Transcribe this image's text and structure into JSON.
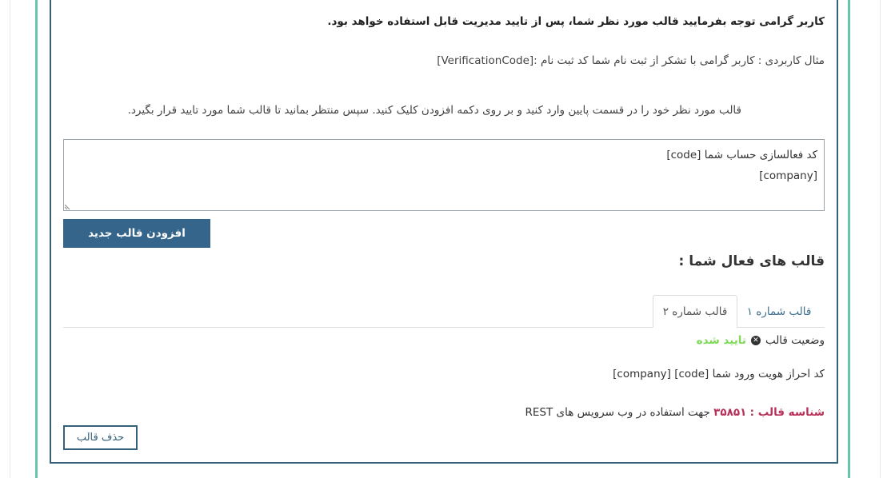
{
  "notice": "کاربر گرامی توجه بفرمایید قالب مورد نظر شما، پس از تایید مدیریت قابل استفاده خواهد بود.",
  "example": "مثال کاربردی : کاربر گرامی با تشکر از ثبت نام شما کد ثبت نام :[VerificationCode]",
  "instructions": "قالب مورد نظر خود را در قسمت پایین وارد کنید و بر روی دکمه افزودن کلیک کنید. سپس منتظر بمانید تا قالب شما مورد تایید قرار بگیرد.",
  "template_input": {
    "value": "کد فعالسازی حساب شما [code]\n[company]"
  },
  "add_button": "افزودن قالب جدید",
  "active_title": "قالب های فعال شما :",
  "tabs": [
    {
      "label": "قالب شماره ۱"
    },
    {
      "label": "قالب شماره ۲"
    }
  ],
  "selected_template": {
    "status_label": "وضعیت قالب",
    "status_value": "تایید شده",
    "text": "کد احراز هویت ورود شما [code] [company]",
    "id_label": "شناسه قالب :",
    "id_value": "۳۵۸۵۱",
    "id_suffix": "جهت استفاده در وب سرویس های REST",
    "delete_button": "حذف قالب"
  },
  "colors": {
    "accent": "#35658a",
    "frame_green": "#69c2ab",
    "status_ok": "#7ed957",
    "id_label": "#b8315a"
  },
  "icons": {
    "status": "close-circle-icon",
    "resize": "resize-grip-icon"
  }
}
